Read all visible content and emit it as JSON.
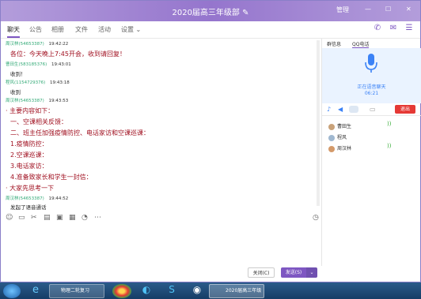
{
  "window": {
    "title": "2020届高三年级部",
    "edit_glyph": "✎",
    "controls": [
      "管理",
      "—",
      "☐",
      "✕"
    ]
  },
  "tabs": [
    {
      "label": "聊天",
      "active": true
    },
    {
      "label": "公告"
    },
    {
      "label": "相册"
    },
    {
      "label": "文件"
    },
    {
      "label": "活动"
    },
    {
      "label": "设置 ⌄"
    }
  ],
  "messages": [
    {
      "sender": "周汉林(54653387)",
      "time": "19:42:22",
      "text": "各位：今天晚上7:45开会，收到请回复！"
    },
    {
      "sender": "曹田生(583185376)",
      "time": "19:43:01",
      "text": "收到！"
    },
    {
      "sender": "程风(1154729376)",
      "time": "19:43:18",
      "text": "收到"
    },
    {
      "sender": "周汉林(54653387)",
      "time": "19:43:53",
      "lines": [
        "· 主要内容如下：",
        "一、空课相关反馈：",
        "二、班主任加强疫情防控、电话家访和空课巡课：",
        "1.疫情防控：",
        "2.空课巡课：",
        "3.电话家访：",
        "4.准备致家长和学生一封信：",
        "· 大家先思考一下"
      ]
    },
    {
      "sender": "周汉林(54653387)",
      "time": "19:44:52",
      "text": "发起了语音通话"
    }
  ],
  "buttons": {
    "close": "关闭(C)",
    "send": "发送(S)",
    "send_arrow": "⌄"
  },
  "right_panel": {
    "tabs": [
      "群信息",
      "QQ电话"
    ],
    "call_status": "正在语音聊天",
    "call_time": "06:21",
    "exit_label": "退出",
    "members": [
      {
        "name": "曹田生"
      },
      {
        "name": "程风"
      },
      {
        "name": "周汉林"
      }
    ]
  },
  "taskbar": {
    "items": [
      {
        "label": "物理二轮复习"
      },
      {
        "label": "2020届高三年级部"
      }
    ]
  },
  "colors": {
    "accent": "#7e57c2",
    "exit_red": "#e53935"
  }
}
